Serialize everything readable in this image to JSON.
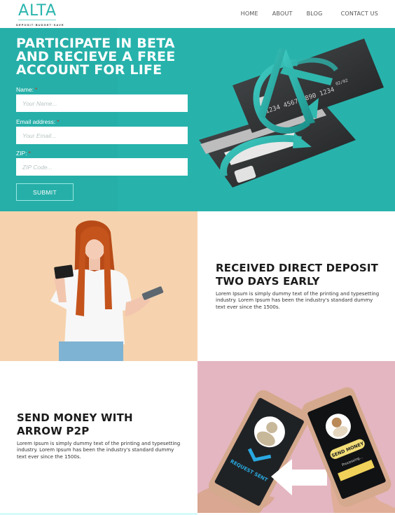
{
  "brand": {
    "name": "ALTA",
    "tagline": "DEPOSIT·BUDGET·SAVE",
    "accent_color": "#2bb5ad"
  },
  "nav": {
    "items": [
      "HOME",
      "ABOUT",
      "BLOG",
      "CONTACT US"
    ]
  },
  "hero": {
    "title_light": "PARTICIPATE IN BETA AND RECIEVE ",
    "title_bold": "A FREE ACCOUNT FOR LIFE",
    "background_color": "#27b3ac",
    "form": {
      "fields": [
        {
          "label": "Name:",
          "required_mark": "*",
          "placeholder": "Your Name...",
          "value": ""
        },
        {
          "label": "Email address:",
          "required_mark": "*",
          "placeholder": "Your Email...",
          "value": ""
        },
        {
          "label": "ZIP:",
          "required_mark": "*",
          "placeholder": "ZIP Code...",
          "value": ""
        }
      ],
      "submit_label": "SUBMIT"
    },
    "card_art": {
      "card_number": "1234 4567 7890 1234",
      "expiry": "02/02",
      "icon": "alta-logo-credit-card"
    }
  },
  "features": [
    {
      "title": "RECEIVED DIRECT DEPOSIT TWO DAYS EARLY",
      "body": "Lorem Ipsum is simply dummy text of the printing and typesetting industry. Lorem Ipsum has been the industry's standard dummy text ever since the 1500s.",
      "image": "woman-holding-card-and-phone",
      "image_bg": "#f6d3ae"
    },
    {
      "title": "SEND MONEY WITH ARROW P2P",
      "body": "Lorem Ipsum is simply dummy text of the printing and typesetting industry. Lorem Ipsum has been the industry's standard dummy text ever since the 1500s.",
      "image": "two-phones-send-money",
      "image_bg": "#e4b6c1",
      "phone_left_text": "REQUEST SENT",
      "phone_right_text": "SEND MONEY",
      "phone_right_status": "Processing..."
    }
  ]
}
